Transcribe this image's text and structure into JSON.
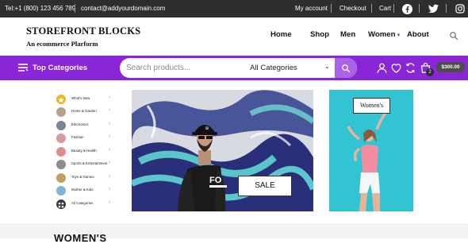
{
  "topbar": {
    "phone": "Tel:+1 (800) 123 456 789",
    "email": "contact@addyourdomain.com",
    "links": [
      "My account",
      "Checkout",
      "Cart"
    ],
    "social": [
      "facebook-icon",
      "twitter-icon",
      "instagram-icon"
    ]
  },
  "header": {
    "brand": "STOREFRONT BLOCKS",
    "tagline": "An ecommerce Plarform",
    "nav": [
      {
        "label": "Home"
      },
      {
        "label": "Shop"
      },
      {
        "label": "Men"
      },
      {
        "label": "Women",
        "has_dropdown": true
      },
      {
        "label": "About"
      }
    ]
  },
  "bar": {
    "top_categories": "Top Categories",
    "search_placeholder": "Search products...",
    "category_select": "All Categories",
    "cart_count": "2",
    "cart_total": "$300.00"
  },
  "categories": [
    {
      "label": "What's New",
      "color": "#e9b62a"
    },
    {
      "label": "Home & Garden",
      "color": "#b8a08c"
    },
    {
      "label": "Electronics",
      "color": "#7a8796"
    },
    {
      "label": "Fashion",
      "color": "#d79aa0"
    },
    {
      "label": "Beauty & Health",
      "color": "#e28b8b"
    },
    {
      "label": "Sports & Entertainment",
      "color": "#8c8c8c"
    },
    {
      "label": "Toys & Games",
      "color": "#c0a060"
    },
    {
      "label": "Mother & Kids",
      "color": "#7fb4d4"
    },
    {
      "label": "All Categories",
      "color": "#3a3a3a"
    }
  ],
  "hero": {
    "sale_label": "SALE",
    "shirt_text": "FO"
  },
  "side_banner": {
    "label": "Women's"
  },
  "section_title": "WOMEN'S",
  "colors": {
    "accent": "#8a25d8",
    "topbar": "#2e2e2e"
  }
}
